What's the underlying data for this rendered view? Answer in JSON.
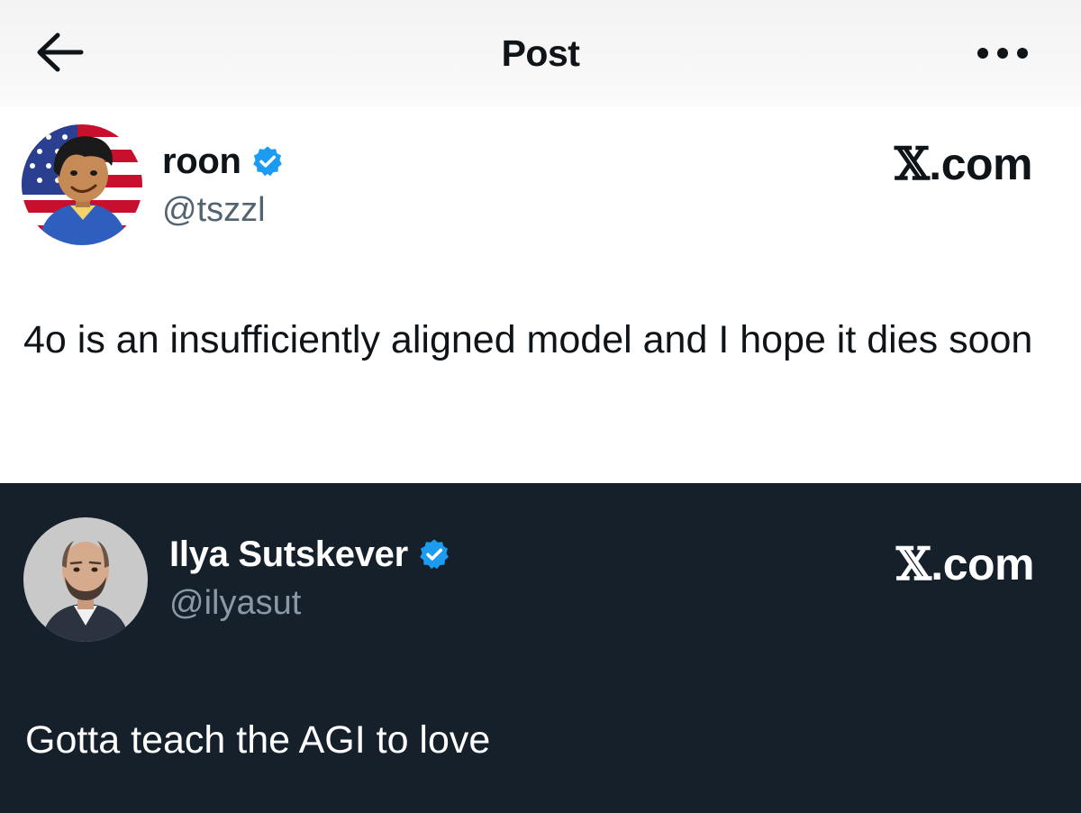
{
  "header": {
    "title": "Post",
    "back_icon": "arrow-left-icon",
    "more_icon": "more-horizontal-icon"
  },
  "tweets": [
    {
      "display_name": "roon",
      "handle": "@tszzl",
      "verified": true,
      "brand": "X.com",
      "text": "4o is an insufficiently aligned model and I hope it dies soon",
      "theme": "light",
      "avatar": "cartoon-avatar-us-flag"
    },
    {
      "display_name": "Ilya Sutskever",
      "handle": "@ilyasut",
      "verified": true,
      "brand": "X.com",
      "text": "Gotta teach the AGI to love",
      "theme": "dark",
      "avatar": "photo-avatar"
    }
  ],
  "colors": {
    "verified_blue": "#1d9bf0",
    "dark_background": "#15202b",
    "light_background": "#ffffff"
  }
}
